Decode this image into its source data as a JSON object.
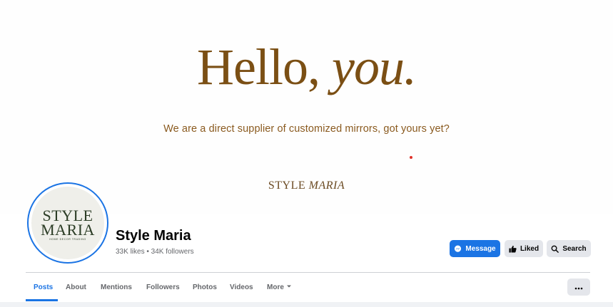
{
  "cover": {
    "headline_part1": "Hello, ",
    "headline_part2": "you.",
    "tagline": "We are a direct supplier of customized mirrors, got yours yet?",
    "brand_part1": "STYLE ",
    "brand_part2": "MARIA"
  },
  "profile": {
    "avatar_line1": "STYLE",
    "avatar_line2": "MARIA",
    "avatar_sub": "HOME DECOR TRADING",
    "name": "Style Maria",
    "stats": "33K likes • 34K followers"
  },
  "actions": {
    "message_label": "Message",
    "liked_label": "Liked",
    "search_label": "Search"
  },
  "tabs": [
    {
      "label": "Posts",
      "active": true
    },
    {
      "label": "About"
    },
    {
      "label": "Mentions"
    },
    {
      "label": "Followers"
    },
    {
      "label": "Photos"
    },
    {
      "label": "Videos"
    },
    {
      "label": "More"
    }
  ],
  "icons": {
    "message": "messenger-icon",
    "liked": "thumbs-up-icon",
    "search": "search-icon",
    "more": "chevron-down-icon",
    "overflow": "ellipsis-icon"
  },
  "colors": {
    "accent": "#1b74e4",
    "cover_text": "#7b4f14",
    "button_gray": "#e4e6eb"
  }
}
